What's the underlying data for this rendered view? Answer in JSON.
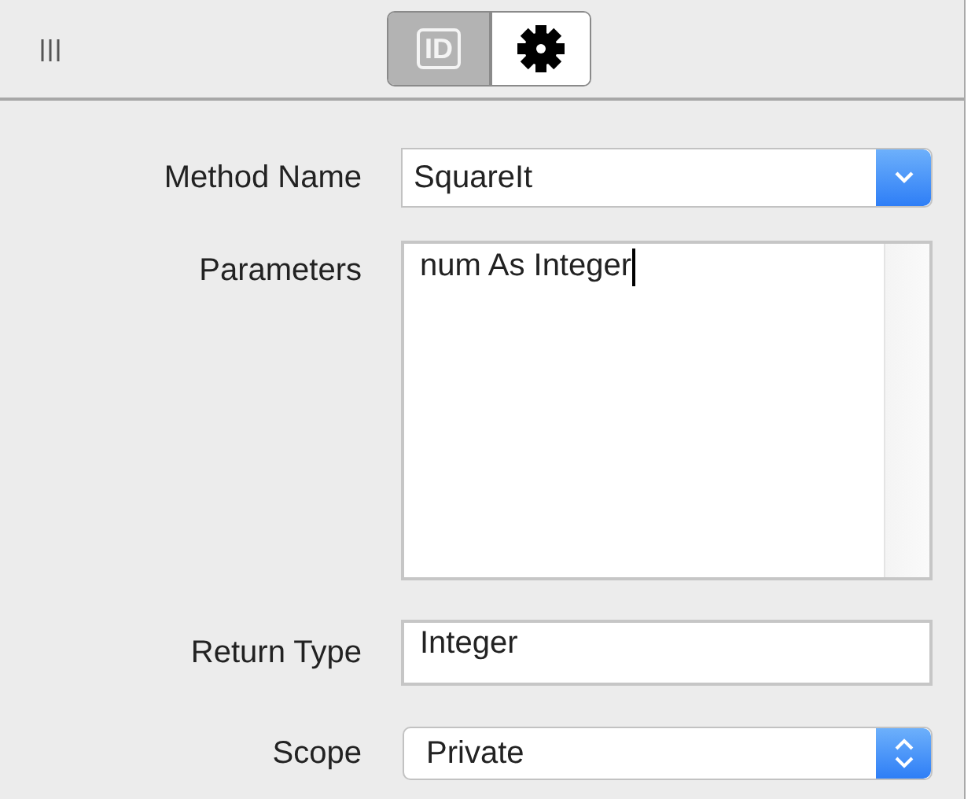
{
  "tabs": [
    {
      "kind": "id",
      "label": "ID",
      "selected": true
    },
    {
      "kind": "settings",
      "selected": false
    }
  ],
  "fields": [
    {
      "kind": "combo",
      "label": "Method Name",
      "value": "SquareIt"
    },
    {
      "kind": "textarea",
      "label": "Parameters",
      "value": "num As Integer",
      "focused": true
    },
    {
      "kind": "text",
      "label": "Return Type",
      "value": "Integer"
    },
    {
      "kind": "popup",
      "label": "Scope",
      "value": "Private"
    }
  ]
}
